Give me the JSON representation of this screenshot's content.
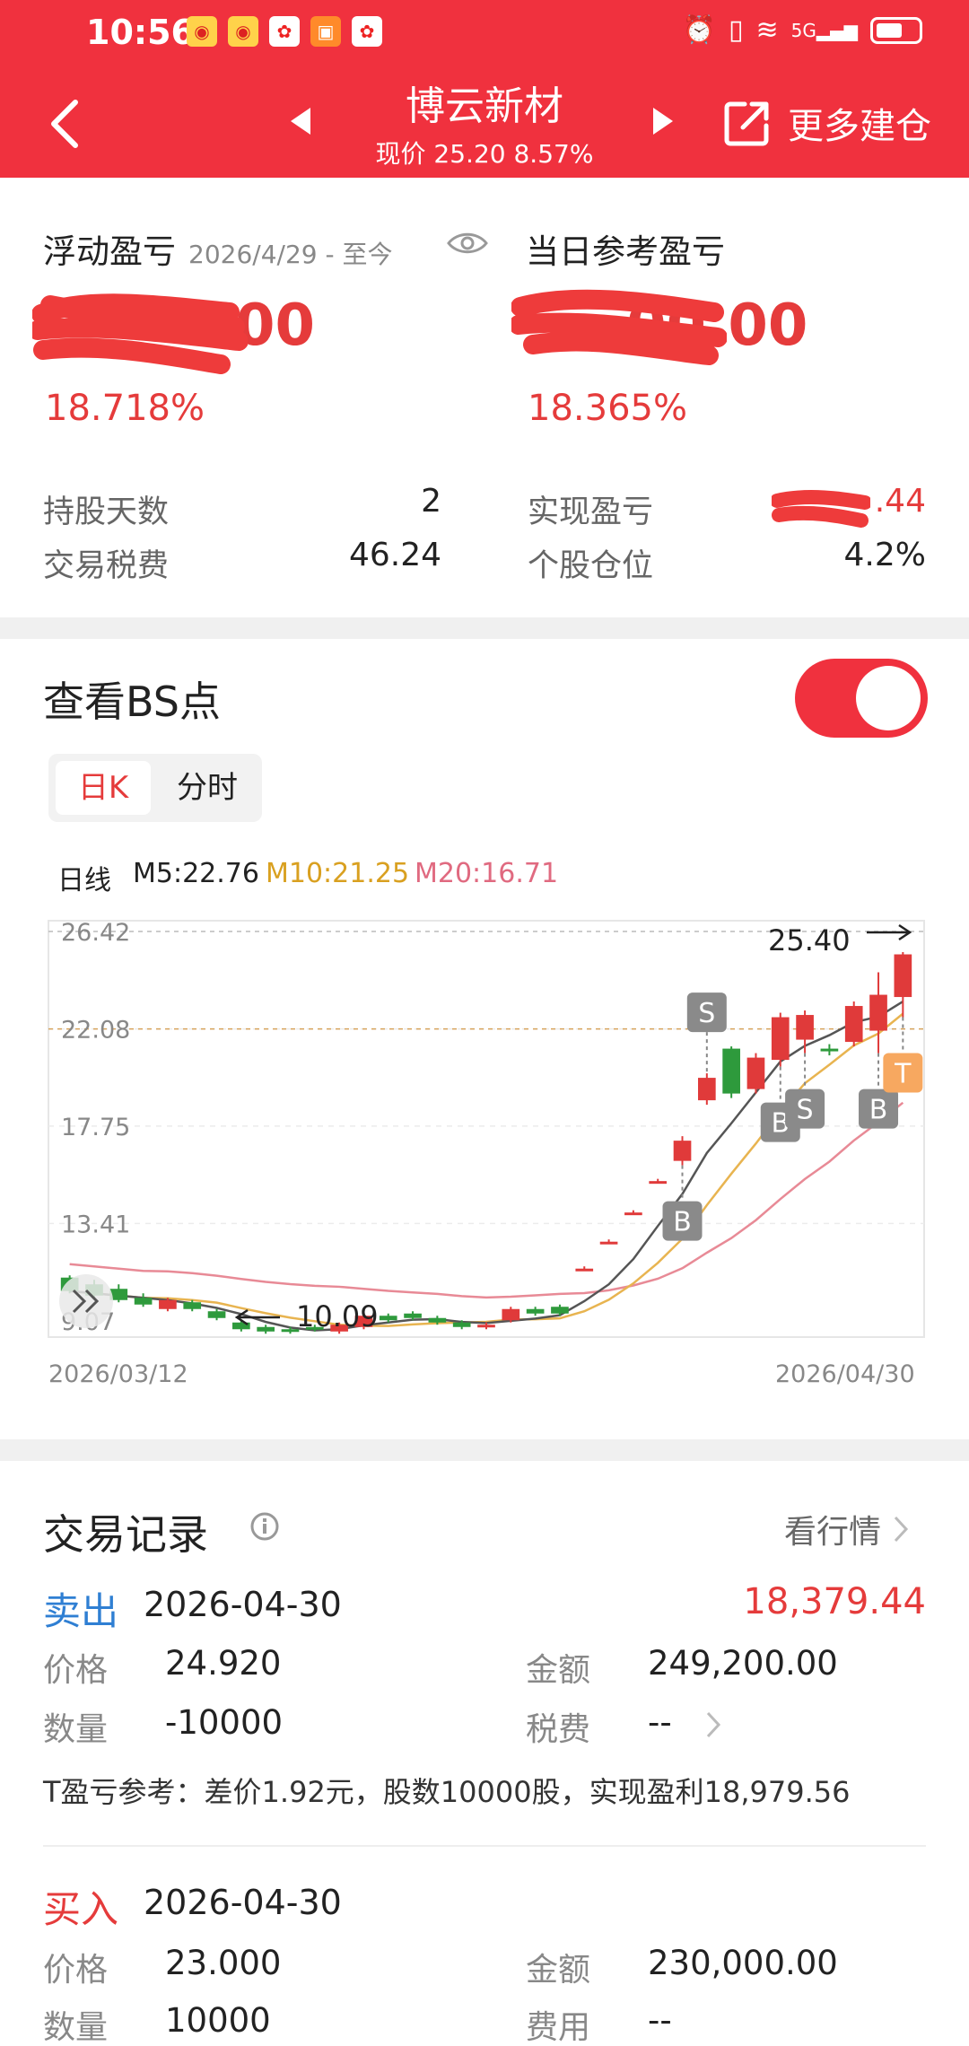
{
  "status_bar": {
    "time": "10:56",
    "network": "5G"
  },
  "header": {
    "title": "博云新材",
    "subtitle": "现价 25.20 8.57%",
    "more_label": "更多建仓"
  },
  "summary": {
    "float_pl_label": "浮动盈亏",
    "float_pl_range": "2026/4/29 - 至今",
    "float_pl_value_visible": "00",
    "float_pl_pct": "18.718%",
    "day_pl_label": "当日参考盈亏",
    "day_pl_value_visible": "00.00",
    "day_pl_pct": "18.365%",
    "hold_days_label": "持股天数",
    "hold_days": "2",
    "tax_label": "交易税费",
    "tax": "46.24",
    "realized_label": "实现盈亏",
    "realized_visible": ".44",
    "position_label": "个股仓位",
    "position": "4.2%"
  },
  "bs_panel": {
    "title": "查看BS点",
    "toggle_on": true,
    "tabs": [
      "日K",
      "分时"
    ],
    "active_tab": "日K",
    "legend": {
      "line_label": "日线",
      "m5": "M5:22.76",
      "m10": "M10:21.25",
      "m20": "M20:16.71"
    }
  },
  "chart_data": {
    "type": "candlestick",
    "y_ticks": [
      "26.42",
      "22.08",
      "17.75",
      "13.41",
      "9.07"
    ],
    "ylim": [
      9.07,
      26.42
    ],
    "x_labels": [
      "2026/03/12",
      "2026/04/30"
    ],
    "high_label": "25.40",
    "low_label": "10.09",
    "ma_colors": {
      "m5": "#555555",
      "m10": "#e8b450",
      "m20": "#e88a96"
    },
    "candles": [
      {
        "o": 11.0,
        "c": 10.4,
        "h": 11.1,
        "l": 10.3
      },
      {
        "o": 10.7,
        "c": 10.2,
        "h": 10.9,
        "l": 10.1
      },
      {
        "o": 10.5,
        "c": 10.0,
        "h": 10.7,
        "l": 9.9
      },
      {
        "o": 10.1,
        "c": 9.8,
        "h": 10.3,
        "l": 9.7
      },
      {
        "o": 9.6,
        "c": 10.0,
        "h": 10.1,
        "l": 9.5
      },
      {
        "o": 9.9,
        "c": 9.6,
        "h": 10.0,
        "l": 9.5
      },
      {
        "o": 9.5,
        "c": 9.2,
        "h": 9.6,
        "l": 9.1
      },
      {
        "o": 9.0,
        "c": 8.7,
        "h": 9.1,
        "l": 8.6
      },
      {
        "o": 8.8,
        "c": 8.6,
        "h": 8.9,
        "l": 8.5
      },
      {
        "o": 8.7,
        "c": 8.6,
        "h": 8.8,
        "l": 8.5
      },
      {
        "o": 8.8,
        "c": 8.7,
        "h": 8.9,
        "l": 8.6
      },
      {
        "o": 8.6,
        "c": 8.9,
        "h": 9.0,
        "l": 8.5
      },
      {
        "o": 8.8,
        "c": 9.3,
        "h": 9.4,
        "l": 8.7
      },
      {
        "o": 9.3,
        "c": 9.1,
        "h": 9.4,
        "l": 9.0
      },
      {
        "o": 9.4,
        "c": 9.2,
        "h": 9.5,
        "l": 9.1
      },
      {
        "o": 9.2,
        "c": 9.0,
        "h": 9.3,
        "l": 8.9
      },
      {
        "o": 9.0,
        "c": 8.8,
        "h": 9.1,
        "l": 8.7
      },
      {
        "o": 8.8,
        "c": 8.9,
        "h": 9.0,
        "l": 8.7
      },
      {
        "o": 9.1,
        "c": 9.6,
        "h": 9.7,
        "l": 9.0
      },
      {
        "o": 9.6,
        "c": 9.4,
        "h": 9.7,
        "l": 9.3
      },
      {
        "o": 9.7,
        "c": 9.4,
        "h": 9.8,
        "l": 9.3
      },
      {
        "o": 11.4,
        "c": 11.4,
        "h": 11.5,
        "l": 11.3
      },
      {
        "o": 12.6,
        "c": 12.6,
        "h": 12.7,
        "l": 12.5
      },
      {
        "o": 13.9,
        "c": 13.9,
        "h": 14.0,
        "l": 13.8
      },
      {
        "o": 15.3,
        "c": 15.3,
        "h": 15.4,
        "l": 15.2
      },
      {
        "o": 16.2,
        "c": 17.1,
        "h": 17.3,
        "l": 16.0
      },
      {
        "o": 18.9,
        "c": 19.9,
        "h": 20.1,
        "l": 18.7
      },
      {
        "o": 21.2,
        "c": 19.2,
        "h": 21.3,
        "l": 19.0
      },
      {
        "o": 19.4,
        "c": 20.8,
        "h": 21.0,
        "l": 19.2
      },
      {
        "o": 20.7,
        "c": 22.6,
        "h": 22.8,
        "l": 20.4
      },
      {
        "o": 21.6,
        "c": 22.7,
        "h": 22.9,
        "l": 21.0
      },
      {
        "o": 21.2,
        "c": 21.1,
        "h": 21.4,
        "l": 20.9
      },
      {
        "o": 21.5,
        "c": 23.1,
        "h": 23.3,
        "l": 21.3
      },
      {
        "o": 22.0,
        "c": 23.6,
        "h": 24.6,
        "l": 21.0
      },
      {
        "o": 23.5,
        "c": 25.4,
        "h": 25.5,
        "l": 22.6
      }
    ],
    "markers": [
      {
        "i": 26,
        "label": "S",
        "pos": "above"
      },
      {
        "i": 25,
        "label": "B",
        "pos": "below"
      },
      {
        "i": 29,
        "label": "B",
        "pos": "below"
      },
      {
        "i": 30,
        "label": "S",
        "pos": "below"
      },
      {
        "i": 33,
        "label": "B",
        "pos": "below"
      },
      {
        "i": 34,
        "label": "T",
        "pos": "below"
      }
    ]
  },
  "trades_header": {
    "title": "交易记录",
    "link": "看行情"
  },
  "trades": [
    {
      "side": "卖出",
      "date": "2026-04-30",
      "pl": "18,379.44",
      "price_label": "价格",
      "price": "24.920",
      "amount_label": "金额",
      "amount": "249,200.00",
      "qty_label": "数量",
      "qty": "-10000",
      "fee_label": "税费",
      "fee": "--",
      "note": "T盈亏参考：差价1.92元，股数10000股，实现盈利18,979.56"
    },
    {
      "side": "买入",
      "date": "2026-04-30",
      "price_label": "价格",
      "price": "23.000",
      "amount_label": "金额",
      "amount": "230,000.00",
      "qty_label": "数量",
      "qty": "10000",
      "fee_label": "费用",
      "fee": "--"
    }
  ]
}
